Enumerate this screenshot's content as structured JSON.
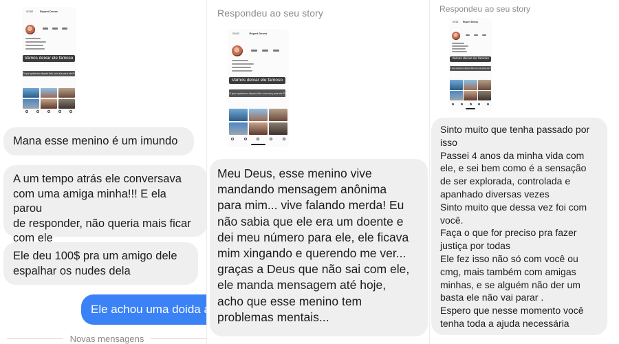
{
  "panel_1": {
    "thumbnail": {
      "time": "00:52",
      "profile_name": "Rupert Deoss",
      "caption_main": "Vamos deixar ele famoso",
      "caption_sub": "O que quiserem depois falo com ele para ele Postar pra meu ver"
    },
    "messages": [
      {
        "text": "Mana esse menino é um imundo"
      },
      {
        "text": "A um tempo atrás ele conversava\ncom uma amiga minha!!! E ela parou\nde responder, não queria mais ficar\ncom ele"
      },
      {
        "text": "Ele deu 100$ pra um amigo dele\nespalhar os nudes dela"
      }
    ],
    "sent_message": "Ele achou uma doida a",
    "divider_label": "Novas mensagens"
  },
  "panel_2": {
    "story_label": "Respondeu ao seu story",
    "thumbnail": {
      "time": "00:52",
      "profile_name": "Rupert Deoss",
      "caption_main": "Vamos deixar ele famoso",
      "caption_sub": "O que quiserem depois falo com ele para ele Postar pra meu ver"
    },
    "message": "Meu Deus, esse menino vive\nmandando mensagem anônima\npara mim... vive falando merda! Eu\nnão sabia que ele era um doente e\ndei meu número para ele, ele ficava\nmim xingando e querendo me ver...\ngraças a Deus que não sai com ele,\nele manda mensagem até hoje,\nacho que esse menino tem\nproblemas mentais..."
  },
  "panel_3": {
    "story_label": "Respondeu ao seu story",
    "thumbnail": {
      "time": "00:52",
      "profile_name": "Rupert Deoss",
      "caption_main": "Vamos deixar ele famoso",
      "caption_sub": "O que quiserem depois falo com ele para ele Postar pra meu ver"
    },
    "message_lines": [
      "Sinto muito que tenha passado por\nisso",
      "Passei 4 anos da minha vida com\nele, e sei bem como é a sensação\nde ser explorada, controlada e\napanhado diversas vezes",
      "Sinto muito que dessa vez foi com\nvocê.",
      "Faça o que for preciso pra fazer\njustiça por todas",
      "Ele fez isso não só com você ou\ncmg, mais também com amigas\nminhas, e se alguém não der um\nbasta ele não vai parar .",
      "Espero que nesse momento você\ntenha toda a ajuda necessária"
    ]
  },
  "colors": {
    "bubble_received": "#efefef",
    "bubble_sent": "#3b82f6",
    "meta_text": "#8a8a8a"
  }
}
